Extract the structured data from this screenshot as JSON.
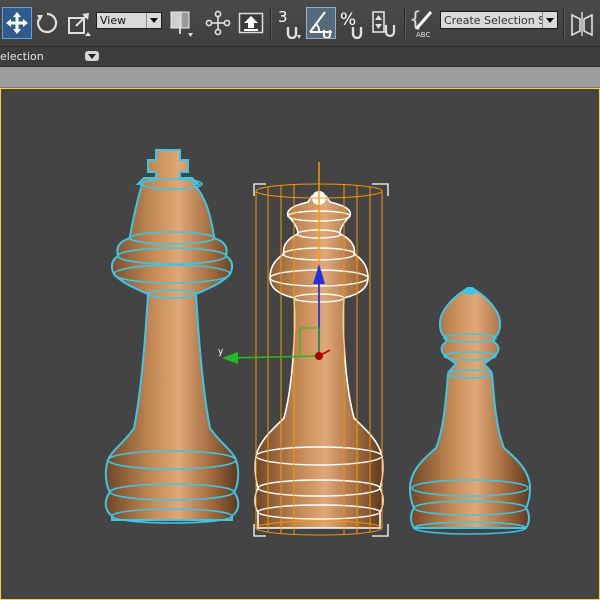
{
  "toolbar": {
    "coordinate_system": "View",
    "snap_label": "3",
    "selection_set_placeholder": "Create Selection Se",
    "tools": [
      "select-and-move",
      "select-and-rotate",
      "select-and-scale",
      "reference-coordinate-system",
      "use-pivot-point-center",
      "select-and-manipulate",
      "keyboard-shortcut-override",
      "snaps-toggle",
      "angle-snap-toggle",
      "percent-snap-toggle",
      "spinner-snap-toggle",
      "edit-named-selection-sets",
      "named-selection-sets",
      "mirror"
    ],
    "active_tool": "select-and-move"
  },
  "ribbon": {
    "label": "election"
  },
  "viewport": {
    "gizmo_axis_label": "y",
    "selected_object": "queen",
    "objects": [
      "king",
      "queen",
      "pawn"
    ],
    "colors": {
      "background": "#444444",
      "wire_unselected": "#3ec6e6",
      "wire_selected": "#ffffff",
      "bounding_box": "#ffffff",
      "pivot_axis": "#ff9900",
      "axis_y": "#22bb22",
      "axis_z": "#2233dd",
      "axis_x": "#cc0000",
      "wood": "#b07a4c"
    }
  }
}
